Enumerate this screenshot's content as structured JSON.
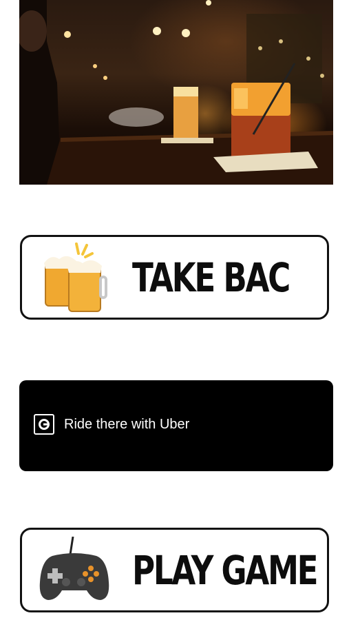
{
  "hero": {
    "image_icon": "bar-drinks-photo"
  },
  "take_bac_button": {
    "label": "TAKE BAC",
    "icon": "clinking-beer-mugs-icon"
  },
  "uber_button": {
    "label": "Ride there with Uber",
    "icon": "uber-logo-icon"
  },
  "play_game_button": {
    "label": "PLAY GAME",
    "icon": "game-controller-icon"
  }
}
